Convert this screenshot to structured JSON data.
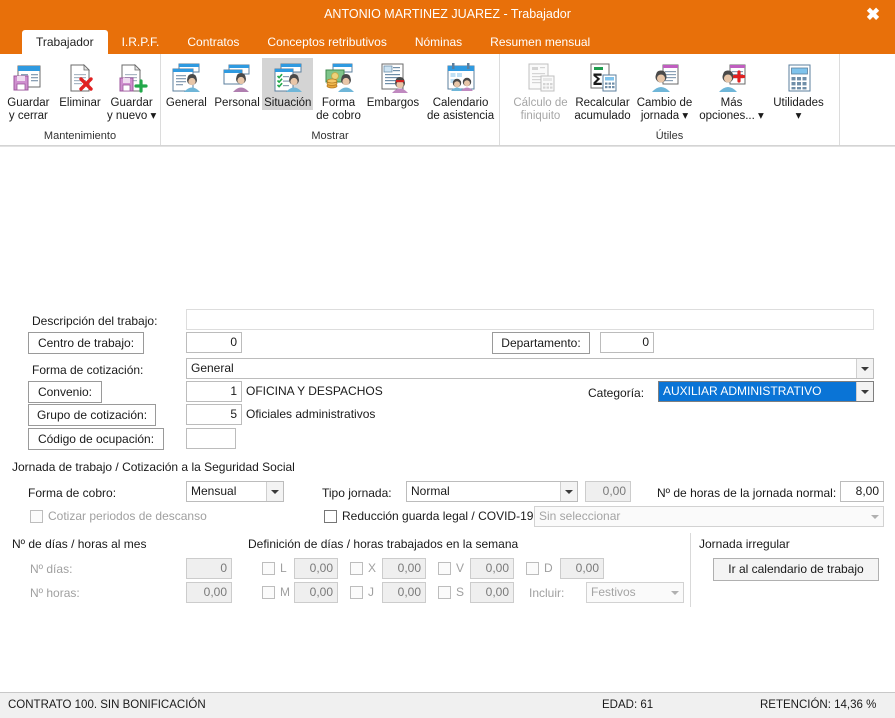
{
  "window": {
    "title": "ANTONIO MARTINEZ JUAREZ - Trabajador",
    "close_label": "✖",
    "accent_color": "#e8700a"
  },
  "tabs": [
    {
      "label": "Trabajador",
      "active": true
    },
    {
      "label": "I.R.P.F.",
      "active": false
    },
    {
      "label": "Contratos",
      "active": false
    },
    {
      "label": "Conceptos retributivos",
      "active": false
    },
    {
      "label": "Nóminas",
      "active": false
    },
    {
      "label": "Resumen mensual",
      "active": false
    }
  ],
  "ribbon": {
    "groups": [
      {
        "label": "Mantenimiento",
        "buttons": [
          {
            "line1": "Guardar",
            "line2": "y cerrar",
            "icon": "save-close-icon",
            "state": "normal"
          },
          {
            "line1": "Eliminar",
            "line2": "",
            "icon": "delete-icon",
            "state": "normal"
          },
          {
            "line1": "Guardar",
            "line2": "y nuevo ▾",
            "icon": "save-new-icon",
            "state": "normal"
          }
        ]
      },
      {
        "label": "Mostrar",
        "buttons": [
          {
            "line1": "General",
            "line2": "",
            "icon": "general-card-icon",
            "state": "normal"
          },
          {
            "line1": "Personal",
            "line2": "",
            "icon": "personal-card-icon",
            "state": "normal"
          },
          {
            "line1": "Situación",
            "line2": "",
            "icon": "situation-icon",
            "state": "selected"
          },
          {
            "line1": "Forma",
            "line2": "de cobro",
            "icon": "payment-method-icon",
            "state": "normal"
          },
          {
            "line1": "Embargos",
            "line2": "",
            "icon": "garnishment-icon",
            "state": "normal"
          },
          {
            "line1": "Calendario",
            "line2": "de asistencia",
            "icon": "attendance-calendar-icon",
            "state": "normal"
          }
        ]
      },
      {
        "label": "Útiles",
        "buttons": [
          {
            "line1": "Cálculo de",
            "line2": "finiquito",
            "icon": "settlement-calc-icon",
            "state": "disabled"
          },
          {
            "line1": "Recalcular",
            "line2": "acumulado",
            "icon": "recalculate-icon",
            "state": "normal"
          },
          {
            "line1": "Cambio de",
            "line2": "jornada ▾",
            "icon": "workday-change-icon",
            "state": "normal"
          },
          {
            "line1": "Más",
            "line2": "opciones... ▾",
            "icon": "more-options-icon",
            "state": "normal"
          },
          {
            "line1": "Utilidades",
            "line2": "▾",
            "icon": "utilities-icon",
            "state": "normal"
          }
        ]
      }
    ]
  },
  "form": {
    "descripcion_label": "Descripción del trabajo:",
    "descripcion_value": "",
    "centro_trabajo_button": "Centro de trabajo:",
    "centro_trabajo_value": "0",
    "departamento_button": "Departamento:",
    "departamento_value": "0",
    "forma_cotizacion_label": "Forma de cotización:",
    "forma_cotizacion_value": "General",
    "convenio_button": "Convenio:",
    "convenio_code": "1",
    "convenio_desc": "OFICINA Y DESPACHOS",
    "categoria_label": "Categoría:",
    "categoria_value": "AUXILIAR ADMINISTRATIVO",
    "grupo_cotizacion_button": "Grupo de cotización:",
    "grupo_cotizacion_code": "5",
    "grupo_cotizacion_desc": "Oficiales administrativos",
    "codigo_ocupacion_button": "Código de ocupación:",
    "codigo_ocupacion_value": "",
    "jornada_section_title": "Jornada de trabajo / Cotización a la Seguridad Social",
    "forma_cobro_label": "Forma de cobro:",
    "forma_cobro_value": "Mensual",
    "tipo_jornada_label": "Tipo jornada:",
    "tipo_jornada_value": "Normal",
    "tipo_jornada_pct": "0,00",
    "horas_jornada_label": "Nº de horas de la jornada normal:",
    "horas_jornada_value": "8,00",
    "cotizar_descanso_label": "Cotizar periodos de descanso",
    "reduccion_label": "Reducción guarda legal / COVID-19",
    "reduccion_select_value": "Sin seleccionar",
    "dias_mes_title": "Nº de días / horas al mes",
    "n_dias_label": "Nº días:",
    "n_dias_value": "0",
    "n_horas_label": "Nº horas:",
    "n_horas_value": "0,00",
    "semana_title": "Definición de días / horas trabajados en la semana",
    "week_days": [
      {
        "letter": "L",
        "value": "0,00"
      },
      {
        "letter": "M",
        "value": "0,00"
      },
      {
        "letter": "X",
        "value": "0,00"
      },
      {
        "letter": "J",
        "value": "0,00"
      },
      {
        "letter": "V",
        "value": "0,00"
      },
      {
        "letter": "S",
        "value": "0,00"
      },
      {
        "letter": "D",
        "value": "0,00"
      }
    ],
    "incluir_label": "Incluir:",
    "incluir_value": "Festivos",
    "jornada_irregular_title": "Jornada irregular",
    "ir_calendario_button": "Ir al calendario de trabajo"
  },
  "statusbar": {
    "contrato": "CONTRATO 100.  SIN BONIFICACIÓN",
    "edad": "EDAD: 61",
    "retencion": "RETENCIÓN: 14,36 %"
  }
}
